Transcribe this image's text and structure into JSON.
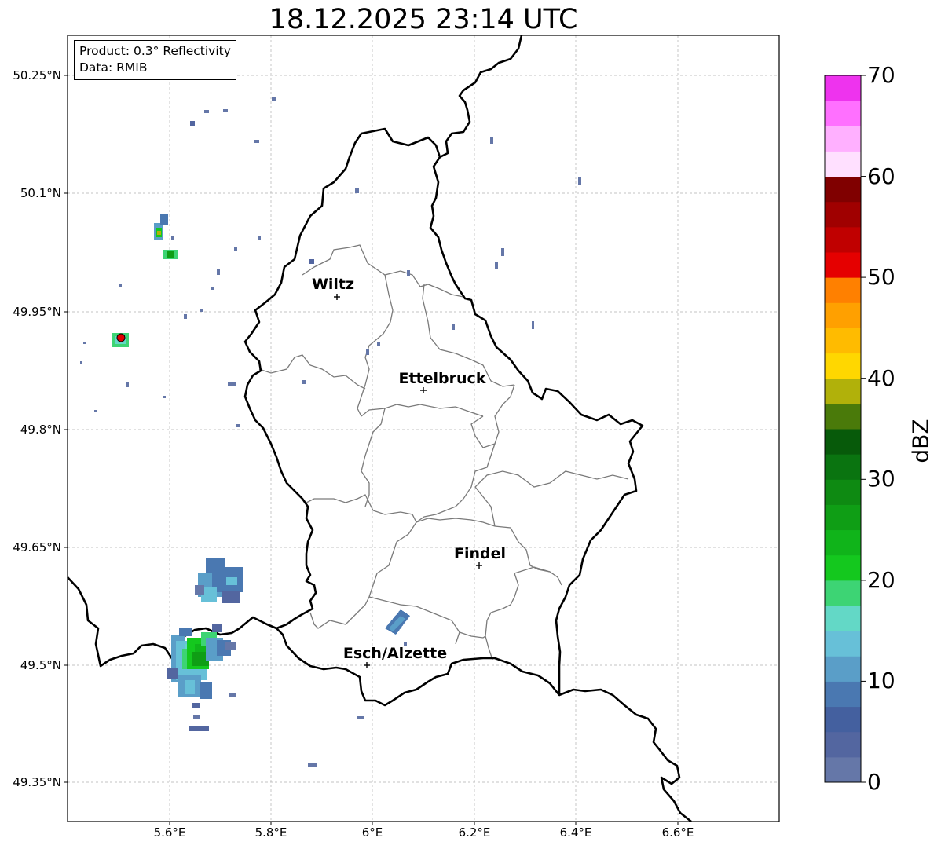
{
  "title": "18.12.2025 23:14 UTC",
  "info_box": {
    "product": "Product: 0.3° Reflectivity",
    "data_source": "Data: RMIB"
  },
  "lat_ticks": [
    "50.25°N",
    "50.1°N",
    "49.95°N",
    "49.8°N",
    "49.65°N",
    "49.5°N",
    "49.35°N"
  ],
  "lon_ticks": [
    "5.6°E",
    "5.8°E",
    "6°E",
    "6.2°E",
    "6.4°E",
    "6.6°E"
  ],
  "cities": [
    {
      "name": "Wiltz"
    },
    {
      "name": "Ettelbruck"
    },
    {
      "name": "Findel"
    },
    {
      "name": "Esch/Alzette"
    }
  ],
  "colorbar": {
    "label": "dBZ",
    "ticks": [
      "0",
      "10",
      "20",
      "30",
      "40",
      "50",
      "60",
      "70"
    ],
    "range": [
      0,
      70
    ],
    "colors": [
      "#6577a8",
      "#5366a0",
      "#44609f",
      "#4a78b1",
      "#5a9ec8",
      "#67c0d8",
      "#63d8c6",
      "#3dd474",
      "#14c81e",
      "#10b41a",
      "#0f9e15",
      "#0e8a12",
      "#0a7410",
      "#075a0a",
      "#4a7a0a",
      "#b1b10a",
      "#ffd700",
      "#ffbb00",
      "#ffa000",
      "#ff8000",
      "#e50000",
      "#c00000",
      "#a00000",
      "#800000",
      "#ffe0ff",
      "#ffb0ff",
      "#ff70ff",
      "#ee33ee"
    ]
  },
  "map": {
    "extent_lon": [
      5.4,
      6.8
    ],
    "extent_lat": [
      49.3,
      50.3
    ],
    "radar_site": {
      "lon": 5.505,
      "lat": 49.914
    }
  }
}
